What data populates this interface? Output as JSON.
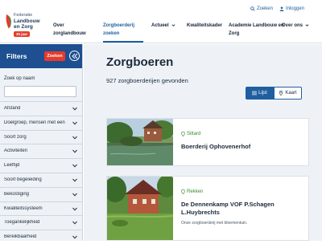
{
  "logo": {
    "line1": "Federatie",
    "line2": "Landbouw",
    "line3": "en Zorg",
    "badge": "30 jaar"
  },
  "toplinks": {
    "search": "Zoeken",
    "login": "Inloggen"
  },
  "nav": {
    "items": [
      {
        "label": "Over zorglandbouw"
      },
      {
        "label": "Zorgboerderij zoeken"
      },
      {
        "label": "Actueel"
      },
      {
        "label": "Kwaliteitskader"
      },
      {
        "label": "Academie Landbouw en Zorg"
      },
      {
        "label": "Over ons"
      }
    ]
  },
  "sidebar": {
    "title": "Filters",
    "search_button": "Zoeken",
    "search_label": "Zoek op naam",
    "search_placeholder": "",
    "filters": [
      {
        "label": "Afstand"
      },
      {
        "label": "Doelgroep, mensen met een"
      },
      {
        "label": "Soort zorg"
      },
      {
        "label": "Activiteiten"
      },
      {
        "label": "Leeftijd"
      },
      {
        "label": "Soort begeleiding"
      },
      {
        "label": "Bekostiging"
      },
      {
        "label": "Kwaliteitssysteem"
      },
      {
        "label": "Toegankelijkheid"
      },
      {
        "label": "Bereikbaarheid"
      }
    ]
  },
  "main": {
    "title": "Zorgboeren",
    "result_count": "927 zorgboerderijen gevonden",
    "view_list": "Lijst",
    "view_map": "Kaart",
    "cards": [
      {
        "location": "Sittard",
        "title": "Boerderij Ophovenerhof",
        "desc": ""
      },
      {
        "location": "Rekken",
        "title": "De Dennenkamp VOF P.Schagen L.Huybrechts",
        "desc": "Onze zorgboerderij met bloementuin."
      }
    ]
  },
  "colors": {
    "primary": "#1d4f91",
    "accent": "#e53b2c",
    "location_green": "#3b8a2a"
  }
}
